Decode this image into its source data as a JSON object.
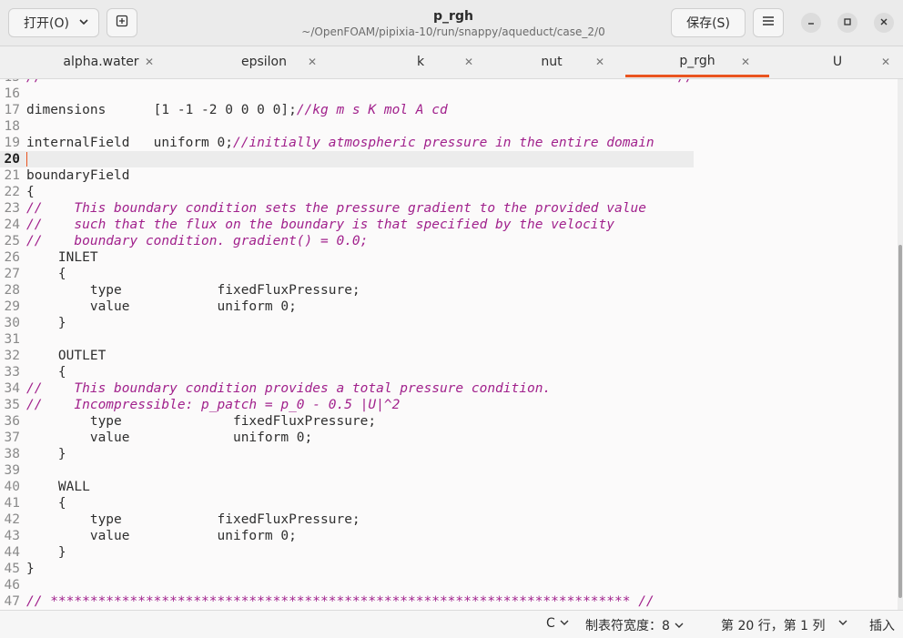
{
  "header": {
    "open_label": "打开(O)",
    "title": "p_rgh",
    "subtitle": "~/OpenFOAM/pipixia-10/run/snappy/aqueduct/case_2/0",
    "save_label": "保存(S)"
  },
  "tabs": [
    {
      "label": "alpha.water"
    },
    {
      "label": "epsilon"
    },
    {
      "label": "k"
    },
    {
      "label": "nut"
    },
    {
      "label": "p_rgh",
      "active": true
    },
    {
      "label": "U"
    }
  ],
  "editor": {
    "current_line": 20,
    "lines": [
      {
        "n": "15",
        "segs": [
          {
            "t": "//                                                                                //",
            "c": true
          }
        ]
      },
      {
        "n": "16",
        "segs": []
      },
      {
        "n": "17",
        "segs": [
          {
            "t": "dimensions      [1 -1 -2 0 0 0 0];"
          },
          {
            "t": "//kg m s K mol A cd",
            "c": true
          }
        ]
      },
      {
        "n": "18",
        "segs": []
      },
      {
        "n": "19",
        "segs": [
          {
            "t": "internalField   uniform 0;"
          },
          {
            "t": "//initially atmospheric pressure in the entire domain",
            "c": true
          }
        ]
      },
      {
        "n": "20",
        "segs": []
      },
      {
        "n": "21",
        "segs": [
          {
            "t": "boundaryField"
          }
        ]
      },
      {
        "n": "22",
        "segs": [
          {
            "t": "{"
          }
        ]
      },
      {
        "n": "23",
        "segs": [
          {
            "t": "//    This boundary condition sets the pressure gradient to the provided value",
            "c": true
          }
        ]
      },
      {
        "n": "24",
        "segs": [
          {
            "t": "//    such that the flux on the boundary is that specified by the velocity",
            "c": true
          }
        ]
      },
      {
        "n": "25",
        "segs": [
          {
            "t": "//    boundary condition. gradient() = 0.0;",
            "c": true
          }
        ]
      },
      {
        "n": "26",
        "segs": [
          {
            "t": "    INLET"
          }
        ]
      },
      {
        "n": "27",
        "segs": [
          {
            "t": "    {"
          }
        ]
      },
      {
        "n": "28",
        "segs": [
          {
            "t": "        type            fixedFluxPressure;"
          }
        ]
      },
      {
        "n": "29",
        "segs": [
          {
            "t": "        value           uniform 0;"
          }
        ]
      },
      {
        "n": "30",
        "segs": [
          {
            "t": "    }"
          }
        ]
      },
      {
        "n": "31",
        "segs": []
      },
      {
        "n": "32",
        "segs": [
          {
            "t": "    OUTLET"
          }
        ]
      },
      {
        "n": "33",
        "segs": [
          {
            "t": "    {"
          }
        ]
      },
      {
        "n": "34",
        "segs": [
          {
            "t": "//    This boundary condition provides a total pressure condition.",
            "c": true
          }
        ]
      },
      {
        "n": "35",
        "segs": [
          {
            "t": "//    Incompressible: p_patch = p_0 - 0.5 |U|^2",
            "c": true
          }
        ]
      },
      {
        "n": "36",
        "segs": [
          {
            "t": "        type              fixedFluxPressure;"
          }
        ]
      },
      {
        "n": "37",
        "segs": [
          {
            "t": "        value             uniform 0;"
          }
        ]
      },
      {
        "n": "38",
        "segs": [
          {
            "t": "    }"
          }
        ]
      },
      {
        "n": "39",
        "segs": []
      },
      {
        "n": "40",
        "segs": [
          {
            "t": "    WALL"
          }
        ]
      },
      {
        "n": "41",
        "segs": [
          {
            "t": "    {"
          }
        ]
      },
      {
        "n": "42",
        "segs": [
          {
            "t": "        type            fixedFluxPressure;"
          }
        ]
      },
      {
        "n": "43",
        "segs": [
          {
            "t": "        value           uniform 0;"
          }
        ]
      },
      {
        "n": "44",
        "segs": [
          {
            "t": "    }"
          }
        ]
      },
      {
        "n": "45",
        "segs": [
          {
            "t": "}"
          }
        ]
      },
      {
        "n": "46",
        "segs": []
      },
      {
        "n": "47",
        "segs": [
          {
            "t": "// ************************************************************************* //",
            "c": true
          }
        ]
      }
    ]
  },
  "status": {
    "language": "C",
    "tab_width": "制表符宽度：8",
    "position": "第 20 行，第 1 列",
    "mode": "插入"
  },
  "colors": {
    "accent": "#e95420",
    "comment": "#a1218c"
  }
}
